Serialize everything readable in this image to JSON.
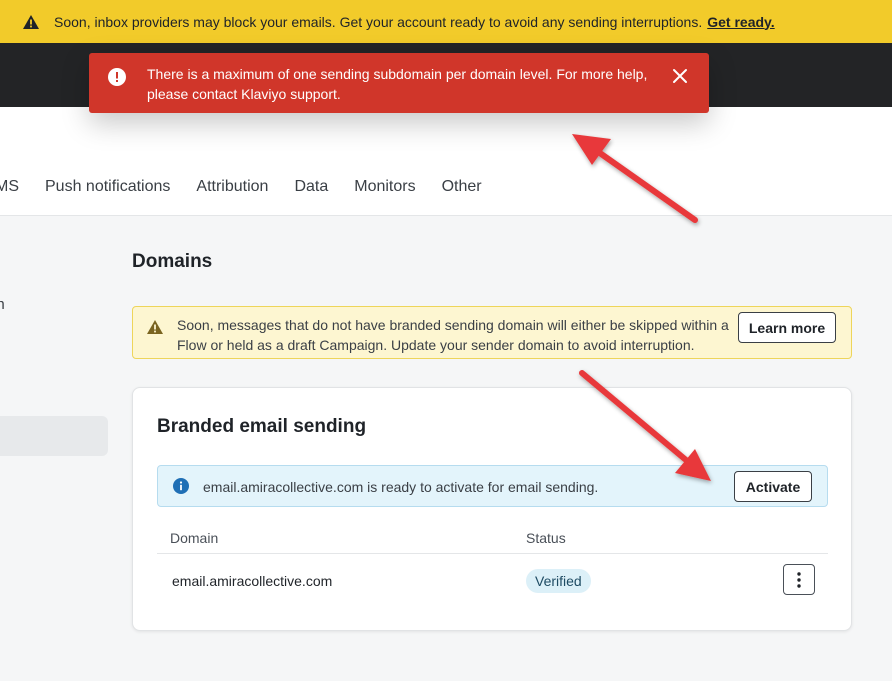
{
  "top_banner": {
    "text": "Soon, inbox providers may block your emails. Get your account ready to avoid any sending interruptions.",
    "link": "Get ready.",
    "bg": "#f2cb2a"
  },
  "toast": {
    "message": "There is a maximum of one sending subdomain per domain level. For more help, please contact Klaviyo support.",
    "bg": "#d0362a"
  },
  "tabs": [
    {
      "label": "MS"
    },
    {
      "label": "Push notifications"
    },
    {
      "label": "Attribution"
    },
    {
      "label": "Data"
    },
    {
      "label": "Monitors"
    },
    {
      "label": "Other"
    }
  ],
  "sidebar": {
    "partial_text": "on"
  },
  "main": {
    "title": "Domains",
    "warning": {
      "text": "Soon, messages that do not have branded sending domain will either be skipped within a Flow or held as a draft Campaign. Update your sender domain to avoid interruption.",
      "button": "Learn more"
    },
    "card": {
      "title": "Branded email sending",
      "info": {
        "text": "email.amiracollective.com is ready to activate for email sending.",
        "button": "Activate"
      },
      "table": {
        "headers": {
          "domain": "Domain",
          "status": "Status"
        },
        "rows": [
          {
            "domain": "email.amiracollective.com",
            "status": "Verified"
          }
        ]
      }
    }
  },
  "icons": {
    "warning": "warning-triangle-icon",
    "error": "exclamation-circle-icon",
    "close": "close-icon",
    "info": "info-circle-icon",
    "more": "more-vertical-icon"
  },
  "annotation_color": "#e8393a"
}
